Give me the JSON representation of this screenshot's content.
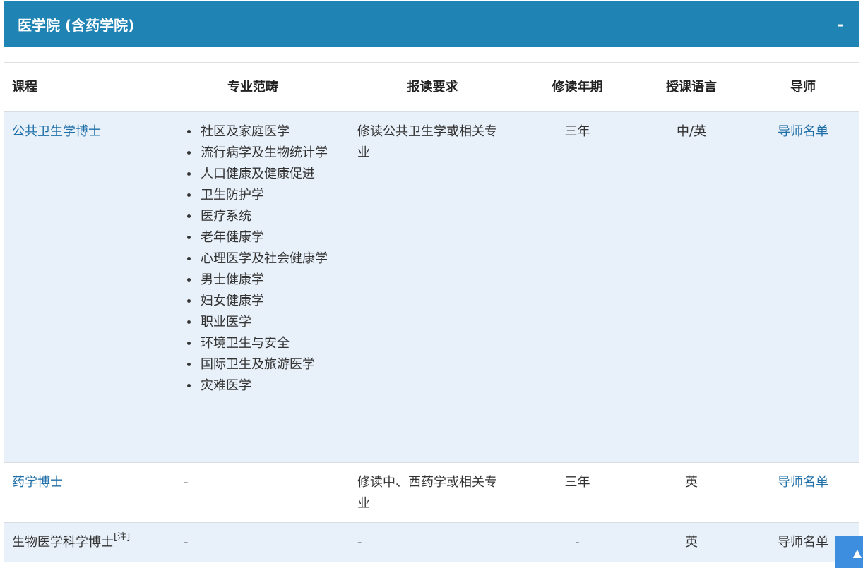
{
  "panel": {
    "title": "医学院 (含药学院)",
    "toggle": "-"
  },
  "table": {
    "headers": [
      "课程",
      "专业范畴",
      "报读要求",
      "修读年期",
      "授课语言",
      "导师"
    ],
    "rows": [
      {
        "course": "公共卫生学博士",
        "specializations": [
          "社区及家庭医学",
          "流行病学及生物统计学",
          "人口健康及健康促进",
          "卫生防护学",
          "医疗系统",
          "老年健康学",
          "心理医学及社会健康学",
          "男士健康学",
          "妇女健康学",
          "职业医学",
          "环境卫生与安全",
          "国际卫生及旅游医学",
          "灾难医学"
        ],
        "requirement": "修读公共卫生学或相关专业",
        "duration": "三年",
        "language": "中/英",
        "supervisor": "导师名单"
      },
      {
        "course": "药学博士",
        "specialization": "-",
        "requirement": "修读中、西药学或相关专业",
        "duration": "三年",
        "language": "英",
        "supervisor": "导师名单"
      },
      {
        "course": "生物医学科学博士",
        "note": "[注]",
        "specialization": "-",
        "requirement": "-",
        "duration": "-",
        "language": "英",
        "supervisor": "导师名单"
      }
    ]
  },
  "scroll_top": {
    "icon": "arrow-up-icon",
    "glyph": "▲"
  }
}
